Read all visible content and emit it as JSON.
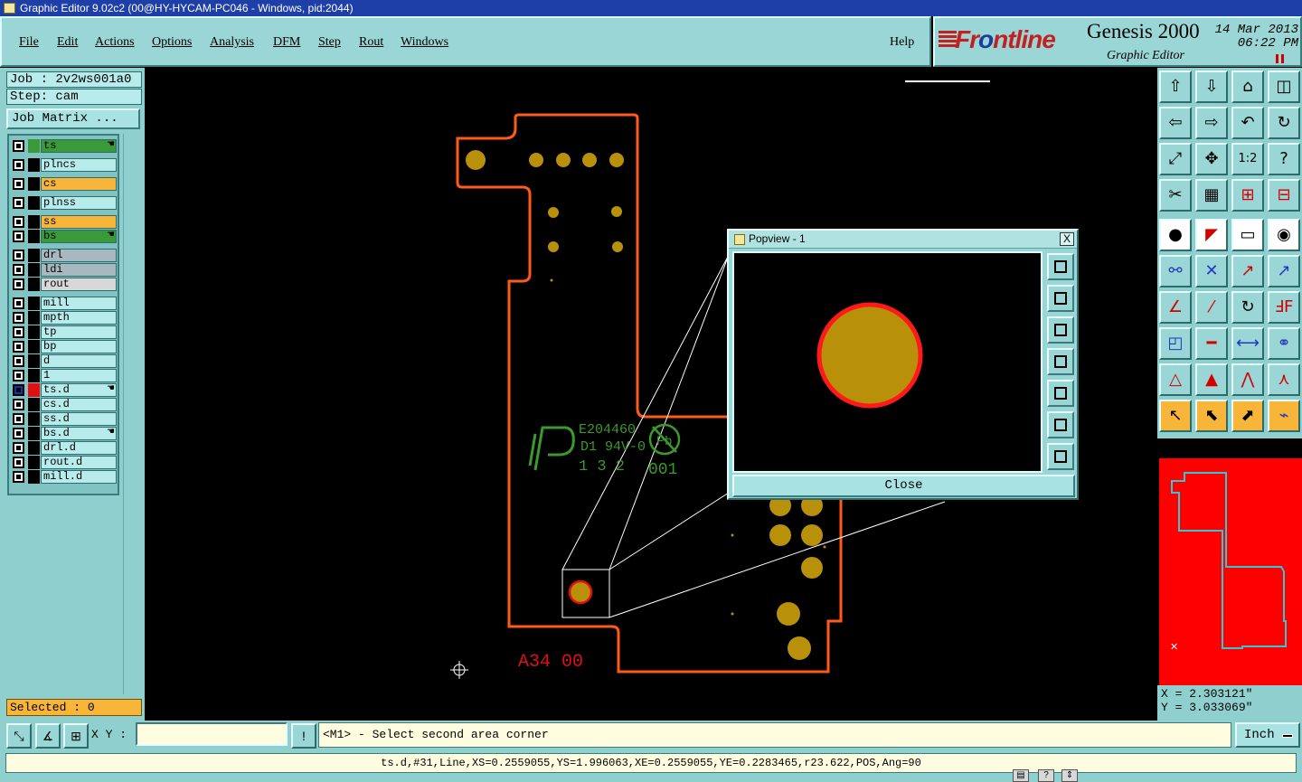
{
  "window": {
    "title": "Graphic Editor 9.02c2 (00@HY-HYCAM-PC046 - Windows, pid:2044)"
  },
  "menu": {
    "items": [
      "File",
      "Edit",
      "Actions",
      "Options",
      "Analysis",
      "DFM",
      "Step",
      "Rout",
      "Windows"
    ],
    "help": "Help"
  },
  "brand": {
    "logo_prefix": "Fr",
    "logo_o": "o",
    "logo_suffix": "ntline",
    "product": "Genesis 2000",
    "subtitle": "Graphic Editor",
    "date": "14 Mar 2013",
    "time": "06:22 PM"
  },
  "left": {
    "job": "Job : 2v2ws001a0",
    "step": "Step: cam",
    "job_matrix": "Job Matrix ...",
    "selected": "Selected : 0",
    "layers": [
      {
        "name": "ts",
        "color": "#3a9a3a",
        "swatch": "#3a9a3a",
        "hand": true
      },
      {
        "name": "plncs",
        "color": "#b8ecec",
        "swatch": "#000000",
        "hand": false
      },
      {
        "name": "cs",
        "color": "#f7b63a",
        "swatch": "#000000",
        "hand": false
      },
      {
        "name": "plnss",
        "color": "#b8ecec",
        "swatch": "#000000",
        "hand": false
      },
      {
        "name": "ss",
        "color": "#f7b63a",
        "swatch": "#000000",
        "hand": false
      },
      {
        "name": "bs",
        "color": "#3a9a3a",
        "swatch": "#000000",
        "hand": true
      },
      {
        "name": "drl",
        "color": "#a8b8c0",
        "swatch": "#000000",
        "hand": false
      },
      {
        "name": "ldi",
        "color": "#a8b8c0",
        "swatch": "#000000",
        "hand": false
      },
      {
        "name": "rout",
        "color": "#d8d8d8",
        "swatch": "#000000",
        "hand": false
      },
      {
        "name": "mill",
        "color": "#b8ecec",
        "swatch": "#000000",
        "hand": false
      },
      {
        "name": "mpth",
        "color": "#b8ecec",
        "swatch": "#000000",
        "hand": false
      },
      {
        "name": "tp",
        "color": "#b8ecec",
        "swatch": "#000000",
        "hand": false
      },
      {
        "name": "bp",
        "color": "#b8ecec",
        "swatch": "#000000",
        "hand": false
      },
      {
        "name": "d",
        "color": "#b8ecec",
        "swatch": "#000000",
        "hand": false
      },
      {
        "name": "1",
        "color": "#b8ecec",
        "swatch": "#000000",
        "hand": false
      },
      {
        "name": "ts.d",
        "color": "#b8ecec",
        "swatch": "#e01010",
        "hand": true,
        "active": true
      },
      {
        "name": "cs.d",
        "color": "#b8ecec",
        "swatch": "#000000",
        "hand": false
      },
      {
        "name": "ss.d",
        "color": "#b8ecec",
        "swatch": "#000000",
        "hand": false
      },
      {
        "name": "bs.d",
        "color": "#b8ecec",
        "swatch": "#000000",
        "hand": true
      },
      {
        "name": "drl.d",
        "color": "#b8ecec",
        "swatch": "#000000",
        "hand": false
      },
      {
        "name": "rout.d",
        "color": "#b8ecec",
        "swatch": "#000000",
        "hand": false
      },
      {
        "name": "mill.d",
        "color": "#b8ecec",
        "swatch": "#000000",
        "hand": false
      }
    ]
  },
  "canvas": {
    "silk_ul": "E204460",
    "silk_rating": "D1 94V-0",
    "silk_date": "1 3 2",
    "silk_pb": "Pb",
    "silk_code": "001",
    "label": "A34 00",
    "colors": {
      "outline": "#ff5a1a",
      "pad": "#b8900a",
      "silk": "#3a9a2a",
      "text": "#e01010"
    }
  },
  "popview": {
    "title": "Popview - 1",
    "close": "Close",
    "close_x": "X"
  },
  "coords": {
    "x": "X = 2.303121\"",
    "y": "Y = 3.033069\""
  },
  "bottom": {
    "xy_label": "X Y :",
    "xy_value": "",
    "prompt": "<M1> - Select second area corner",
    "units": "Inch",
    "status": "ts.d,#31,Line,XS=0.2559055,YS=1.996063,XE=0.2559055,YE=0.2283465,r23.622,POS,Ang=90"
  }
}
